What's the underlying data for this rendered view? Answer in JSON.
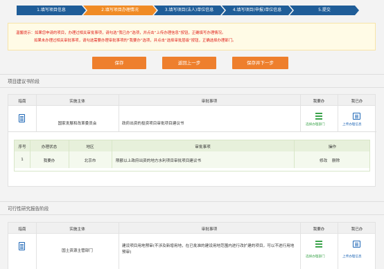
{
  "steps": [
    {
      "label": "1.填写项目信息"
    },
    {
      "label": "2.填写项目办理情况"
    },
    {
      "label": "3.填写项目(法人)单位信息"
    },
    {
      "label": "4.填写项目(申报)单位信息"
    },
    {
      "label": "5.提交"
    }
  ],
  "notice": {
    "line1": "温馨提示：如果您申请的项目，办理过相关审批事项，请勾选“我已办”选项，并点击“上传办理信息”按钮，正确填写办理情况。",
    "line2": "如果未办理过相关审批事项，请勾选需要办理审批事项的“我要办”选项，并点击“选择审批层级”按钮，正确选择办理部门。"
  },
  "actions": {
    "save": "保存",
    "back": "返回上一步",
    "save_next": "保存并下一步"
  },
  "section1": {
    "title": "项目建议书阶段",
    "headers": {
      "guide": "指南",
      "subject": "实施主体",
      "item": "审批事项",
      "todo": "我要办",
      "done": "我已办"
    },
    "row": {
      "subject": "国家发展和改革委员会",
      "item": "政府出资的投资项目审批项目建议书",
      "todo_link": "选择办理部门",
      "done_link": "上传办理信息"
    },
    "sub": {
      "headers": {
        "no": "序号",
        "status": "办理状态",
        "region": "地区",
        "item": "审批事项",
        "op": "操作"
      },
      "row": {
        "no": "1",
        "status": "我要办",
        "region": "北京市",
        "item": "限额以上政府出资的地方水利项目审批项目建议书",
        "edit": "修改",
        "del": "删除"
      }
    }
  },
  "section2": {
    "title": "可行性研究报告阶段",
    "headers": {
      "guide": "指南",
      "subject": "实施主体",
      "item": "审批事项",
      "todo": "我要办",
      "done": "我已办"
    },
    "row": {
      "subject": "国土资源主管部门",
      "item": "建设项目用地预审(不涉及新增用地，在已批准的建设用地范围内进行改扩建的项目，可以不进行用地预审)",
      "todo_link": "选择办理部门",
      "done_link": "上传办理信息"
    }
  },
  "colors": {
    "step_active": "#f08b25",
    "step": "#1f5d98",
    "button": "#ee7f2d",
    "notice_text": "#e0211b"
  }
}
